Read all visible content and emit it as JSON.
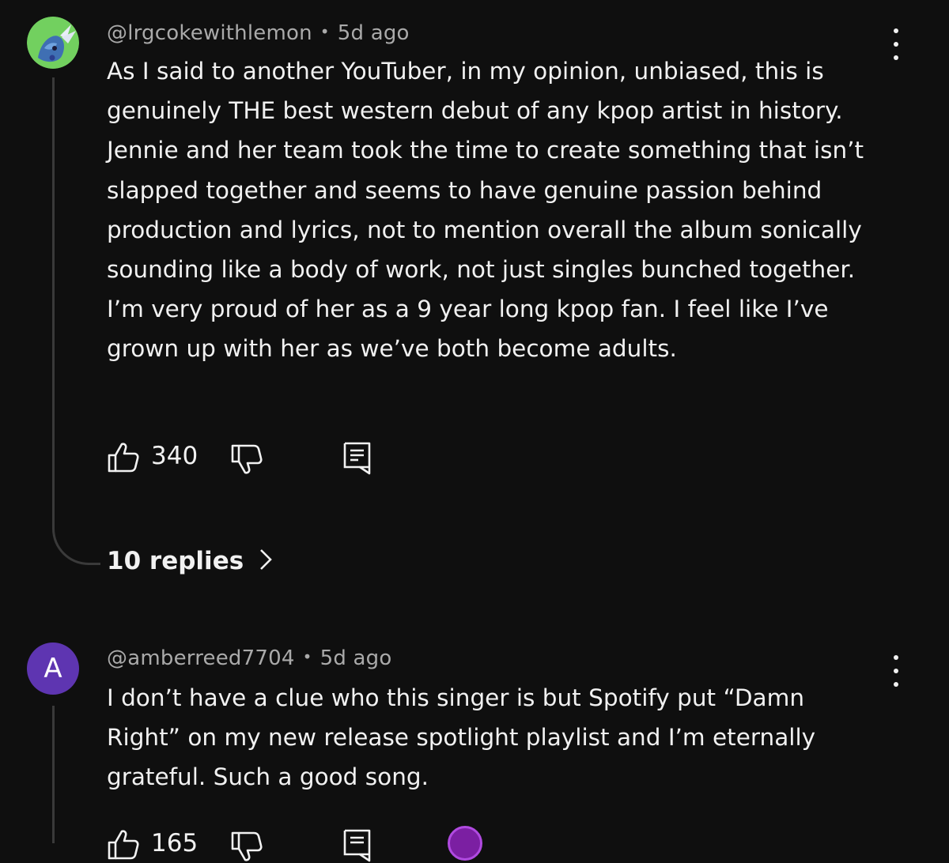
{
  "comments": [
    {
      "handle": "@lrgcokewithlemon",
      "separator": "•",
      "time": "5d ago",
      "text": "As I said to another YouTuber, in my opinion, unbiased, this is genuinely THE best western debut of any kpop artist in history. Jennie and her team took the time to create something that isn’t slapped together and seems to have genuine passion behind production and lyrics, not to mention overall the album sonically sounding like a body of work, not just singles bunched together. I’m very proud of her as a 9 year long kpop fan. I feel like I’ve grown up with her as we’ve both become adults.",
      "likes": "340",
      "replies_label": "10 replies",
      "avatar_icon": "dragon-avatar-icon"
    },
    {
      "handle": "@amberreed7704",
      "separator": "•",
      "time": "5d ago",
      "avatar_letter": "A",
      "text": "I don’t have a clue who this singer is but Spotify put “Damn Right” on my new release spotlight playlist and I’m eternally grateful. Such a good song.",
      "likes": "165"
    }
  ],
  "colors": {
    "background": "#0f0f0f",
    "text": "#f1f1f1",
    "meta": "#aaaaaa",
    "avatar_purple": "#5e35b1",
    "thread_line": "#3a3a3a"
  }
}
